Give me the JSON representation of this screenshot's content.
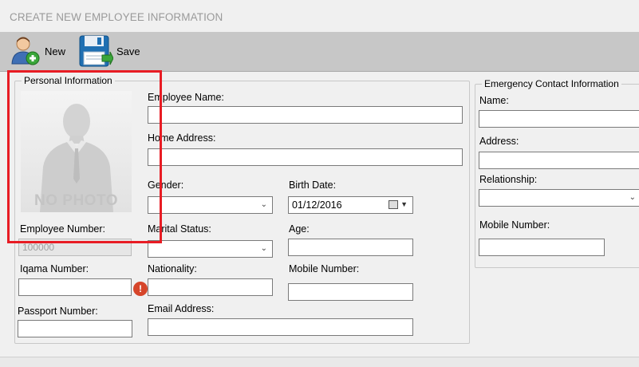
{
  "window": {
    "title": "CREATE NEW EMPLOYEE INFORMATION"
  },
  "toolbar": {
    "new_label": "New",
    "save_label": "Save"
  },
  "personal": {
    "legend": "Personal Information",
    "photo_text": "NO PHOTO",
    "employee_name_label": "Employee Name:",
    "home_address_label": "Home Address:",
    "gender_label": "Gender:",
    "birth_date_label": "Birth Date:",
    "birth_date_value": "01/12/2016",
    "employee_number_label": "Employee Number:",
    "employee_number_value": "100000",
    "marital_status_label": "Marital Status:",
    "age_label": "Age:",
    "iqama_label": "Iqama Number:",
    "nationality_label": "Nationality:",
    "mobile_label": "Mobile Number:",
    "passport_label": "Passport Number:",
    "email_label": "Email Address:"
  },
  "emergency": {
    "legend": "Emergency Contact Information",
    "name_label": "Name:",
    "address_label": "Address:",
    "relationship_label": "Relationship:",
    "mobile_label": "Mobile Number:"
  },
  "colors": {
    "highlight_box": "#e81c24",
    "error_icon": "#d6452a"
  },
  "icons": {
    "new": "user-add-icon",
    "save": "floppy-save-icon",
    "error": "error-icon"
  }
}
